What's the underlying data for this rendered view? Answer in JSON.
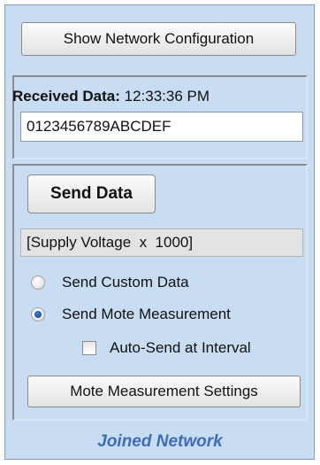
{
  "header": {
    "show_network_config_label": "Show Network Configuration"
  },
  "received": {
    "label": "Received Data:",
    "time": "12:33:36 PM",
    "value": "0123456789ABCDEF"
  },
  "send": {
    "button_label": "Send Data",
    "preview_text": "[Supply Voltage  x  1000]",
    "options": {
      "custom_label": "Send Custom Data",
      "custom_selected": false,
      "mote_label": "Send Mote Measurement",
      "mote_selected": true
    },
    "auto_send": {
      "label": "Auto-Send at Interval",
      "checked": false
    },
    "settings_button_label": "Mote Measurement Settings"
  },
  "status": {
    "text": "Joined Network",
    "color": "#3d6cb8"
  },
  "colors": {
    "panel_bg": "#c8dcf2",
    "button_bg": "#ececec",
    "radio_selected": "#1f5fb0"
  }
}
